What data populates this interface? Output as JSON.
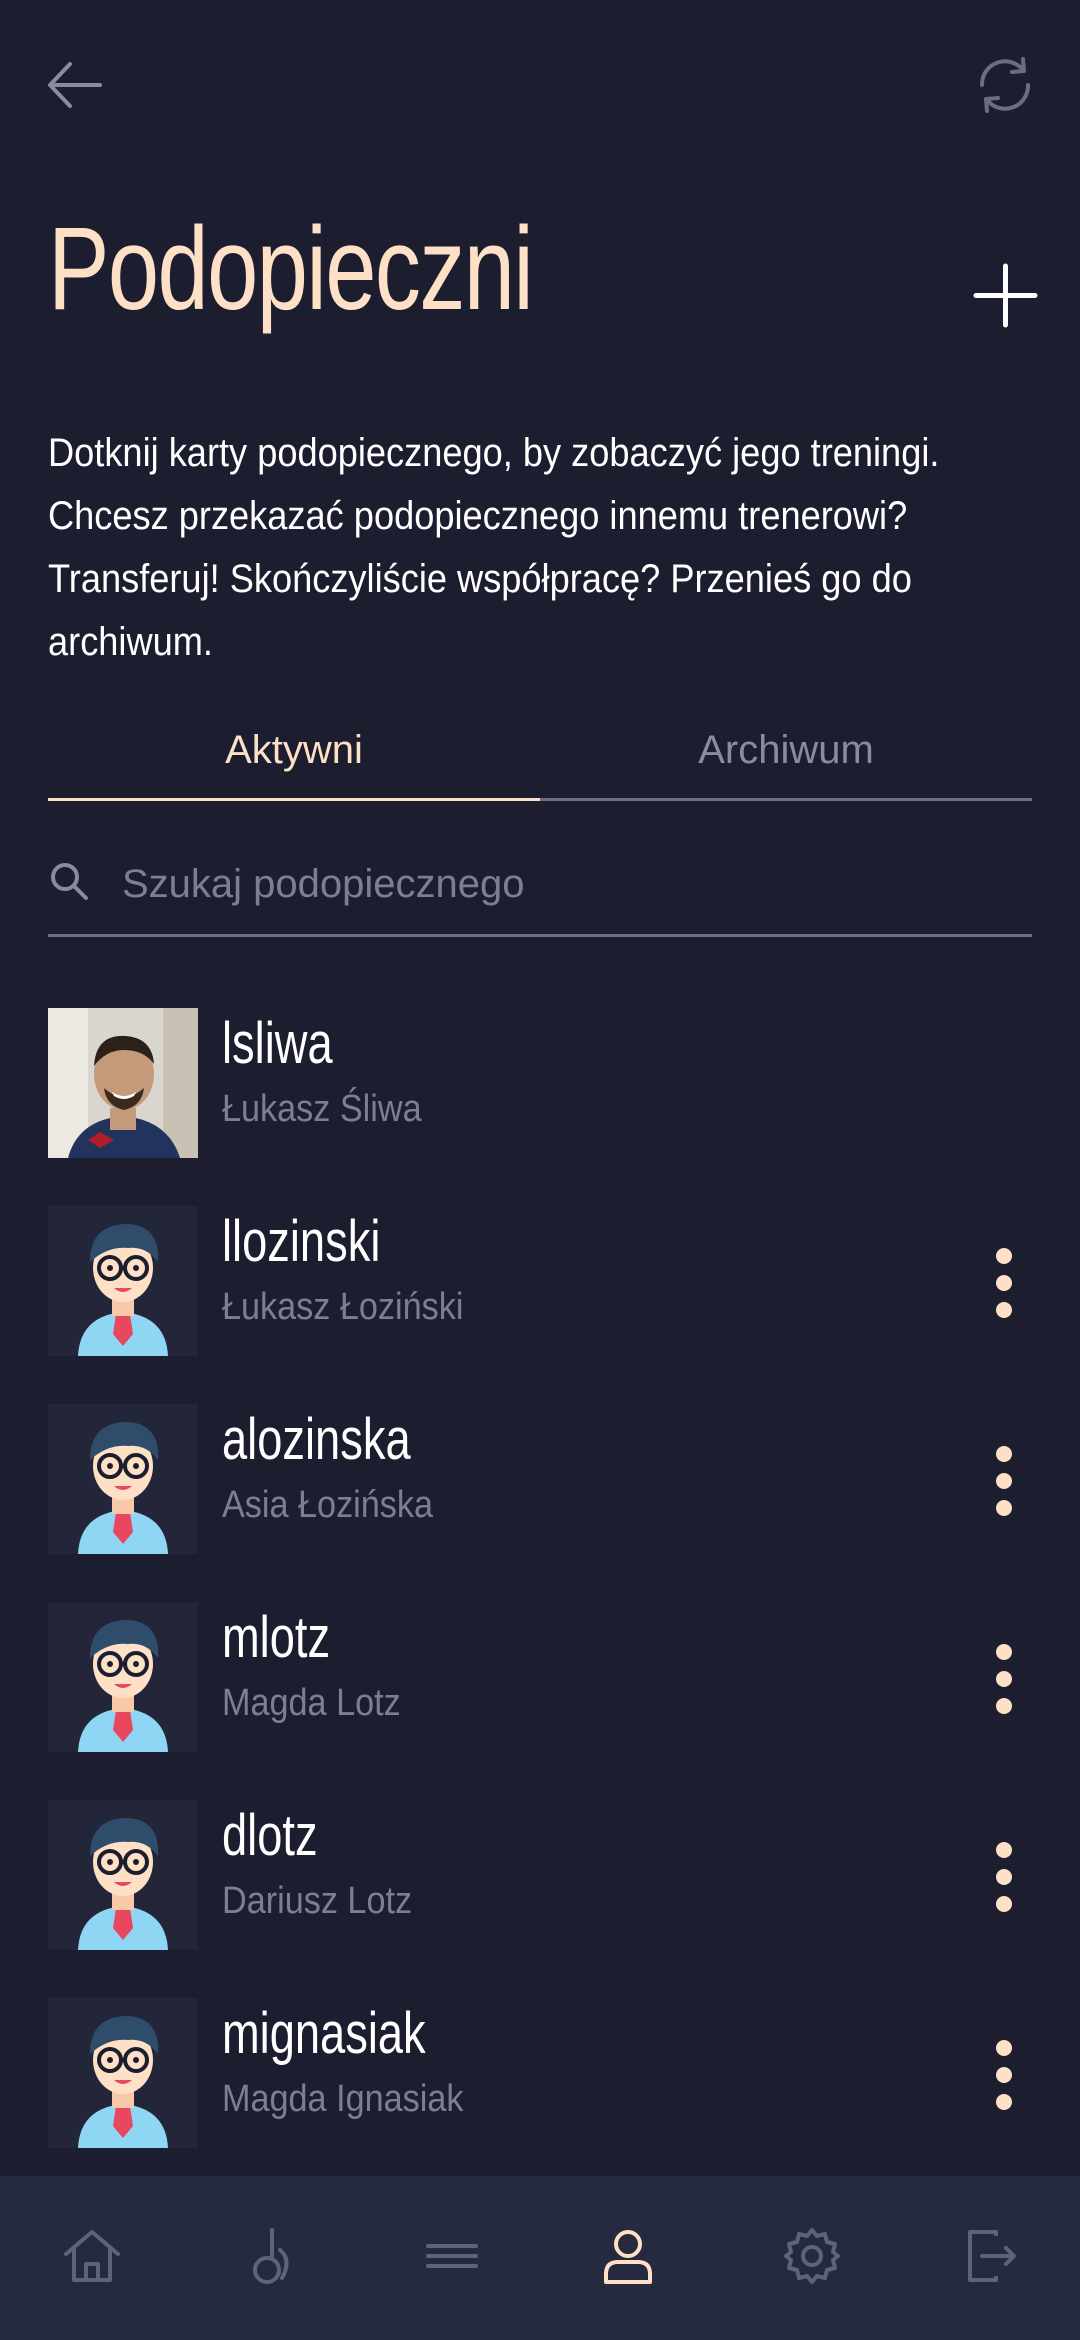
{
  "header": {
    "title": "Podopieczni",
    "description": "Dotknij karty podopiecznego, by zobaczyć jego treningi.\nChcesz przekazać podopiecznego innemu trenerowi?\nTransferuj! Skończyliście współpracę? Przenieś go do\narchiwum.",
    "icons": {
      "back": "arrow-left-icon",
      "refresh": "refresh-icon",
      "add": "plus-icon"
    }
  },
  "tabs": [
    {
      "label": "Aktywni",
      "active": true
    },
    {
      "label": "Archiwum",
      "active": false
    }
  ],
  "search": {
    "placeholder": "Szukaj podopiecznego",
    "value": ""
  },
  "clients": [
    {
      "username": "lsliwa",
      "full_name": "Łukasz Śliwa",
      "avatar": "photo",
      "has_menu": false
    },
    {
      "username": "llozinski",
      "full_name": "Łukasz Łoziński",
      "avatar": "default-avatar",
      "has_menu": true
    },
    {
      "username": "alozinska",
      "full_name": "Asia Łozińska",
      "avatar": "default-avatar",
      "has_menu": true
    },
    {
      "username": "mlotz",
      "full_name": "Magda Lotz",
      "avatar": "default-avatar",
      "has_menu": true
    },
    {
      "username": "dlotz",
      "full_name": "Dariusz Lotz",
      "avatar": "default-avatar",
      "has_menu": true
    },
    {
      "username": "mignasiak",
      "full_name": "Magda Ignasiak",
      "avatar": "default-avatar",
      "has_menu": true
    }
  ],
  "bottom_nav": [
    {
      "icon": "home-icon",
      "active": false
    },
    {
      "icon": "kettlebell-icon",
      "active": false
    },
    {
      "icon": "menu-icon",
      "active": false
    },
    {
      "icon": "user-icon",
      "active": true
    },
    {
      "icon": "settings-icon",
      "active": false
    },
    {
      "icon": "logout-icon",
      "active": false
    }
  ],
  "colors": {
    "background": "#1c1e30",
    "accent": "#fde0c5",
    "muted": "#7c7e92",
    "nav_bg": "#262a3e"
  }
}
